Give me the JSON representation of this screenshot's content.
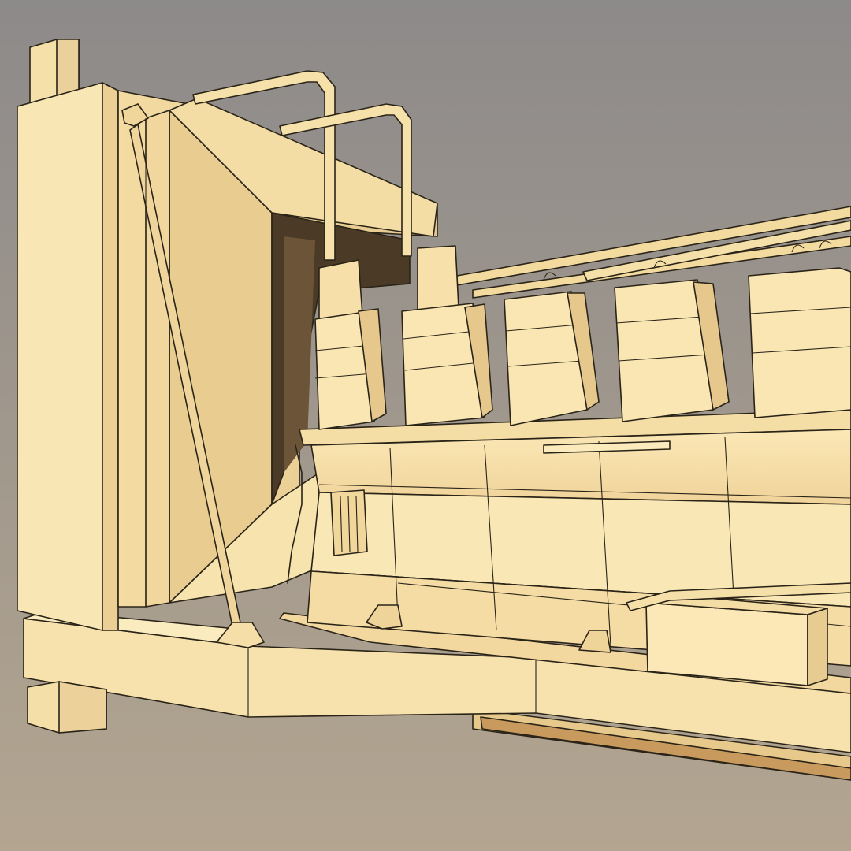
{
  "scene": {
    "subject": "generator-set-wireframe-render",
    "colors": {
      "background_top": "#8d8a8a",
      "background_bottom": "#b3a590",
      "model_light": "#fbe9b8",
      "model_mid": "#efd59a",
      "model_shadow": "#d9b579",
      "model_deep": "#b08955",
      "edge_line": "#2a2418",
      "dark_interior": "#4a3a26"
    },
    "cylinder_heads_visible": 5
  }
}
